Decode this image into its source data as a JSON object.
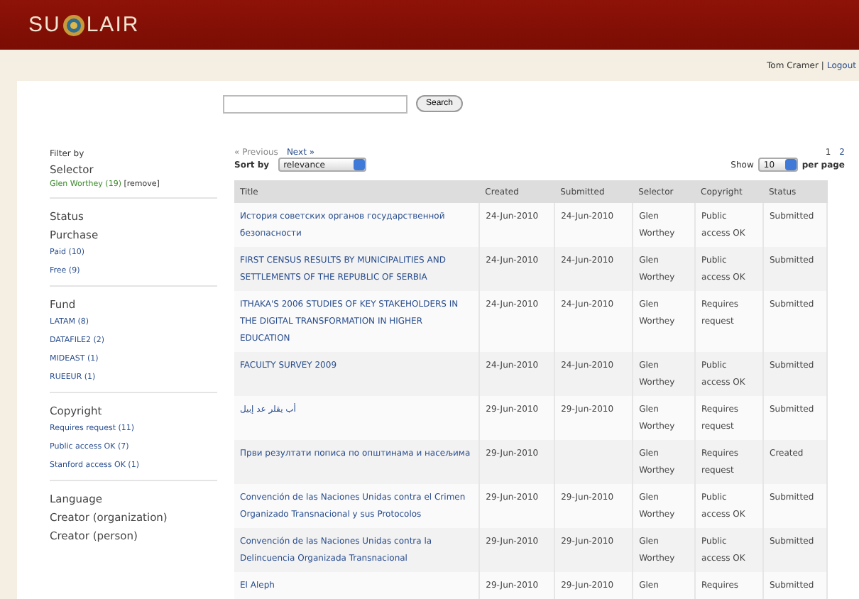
{
  "header": {
    "logo_left": "SU",
    "logo_right": "LAIR"
  },
  "user_bar": {
    "user": "Tom Cramer",
    "separator": "|",
    "logout": "Logout"
  },
  "search": {
    "button": "Search"
  },
  "sidebar": {
    "title": "Filter by",
    "active_filter": {
      "facet": "Selector",
      "value": "Glen Worthey (19)",
      "remove": "[remove]"
    },
    "sections": [
      [
        {
          "heading": "Status"
        },
        {
          "heading": "Purchase",
          "items": [
            "Paid (10)",
            "Free (9)"
          ]
        }
      ],
      [
        {
          "heading": "Fund",
          "items": [
            "LATAM (8)",
            "DATAFILE2 (2)",
            "MIDEAST (1)",
            "RUEEUR (1)"
          ]
        }
      ],
      [
        {
          "heading": "Copyright",
          "items": [
            "Requires request (11)",
            "Public access OK (7)",
            "Stanford access OK (1)"
          ]
        }
      ],
      [
        {
          "heading": "Language"
        },
        {
          "heading": "Creator (organization)"
        },
        {
          "heading": "Creator (person)"
        }
      ]
    ]
  },
  "pager": {
    "previous": {
      "label": "« Previous",
      "disabled": true
    },
    "next": {
      "label": "Next »",
      "disabled": false
    },
    "pages": [
      {
        "label": "1",
        "selected": true
      },
      {
        "label": "2",
        "selected": false
      }
    ]
  },
  "sort": {
    "label": "Sort by",
    "value": "relevance"
  },
  "per_page": {
    "label": "Show",
    "value": "10",
    "suffix": "per page"
  },
  "table": {
    "columns": [
      "Title",
      "Created",
      "Submitted",
      "Selector",
      "Copyright",
      "Status"
    ],
    "rows": [
      [
        "История советских органов государственной безопасности",
        "24-Jun-2010",
        "24-Jun-2010",
        "Glen Worthey",
        "Public access OK",
        "Submitted"
      ],
      [
        "FIRST CENSUS RESULTS BY MUNICIPALITIES AND SETTLEMENTS OF THE REPUBLIC OF SERBIA",
        "24-Jun-2010",
        "24-Jun-2010",
        "Glen Worthey",
        "Public access OK",
        "Submitted"
      ],
      [
        "ITHAKA'S 2006 STUDIES OF KEY STAKEHOLDERS IN THE DIGITAL TRANSFORMATION IN HIGHER EDUCATION",
        "24-Jun-2010",
        "24-Jun-2010",
        "Glen Worthey",
        "Requires request",
        "Submitted"
      ],
      [
        "FACULTY SURVEY 2009",
        "24-Jun-2010",
        "24-Jun-2010",
        "Glen Worthey",
        "Public access OK",
        "Submitted"
      ],
      [
        "أب يقلر عد إبيل",
        "29-Jun-2010",
        "29-Jun-2010",
        "Glen Worthey",
        "Requires request",
        "Submitted"
      ],
      [
        "Први резултати пописа по општинама и насељима",
        "29-Jun-2010",
        "",
        "Glen Worthey",
        "Requires request",
        "Created"
      ],
      [
        "Convención de las Naciones Unidas contra el Crimen Organizado Transnacional y sus Protocolos",
        "29-Jun-2010",
        "29-Jun-2010",
        "Glen Worthey",
        "Public access OK",
        "Submitted"
      ],
      [
        "Convención de las Naciones Unidas contra la Delincuencia Organizada Transnacional",
        "29-Jun-2010",
        "29-Jun-2010",
        "Glen Worthey",
        "Public access OK",
        "Submitted"
      ],
      [
        "El Aleph",
        "29-Jun-2010",
        "29-Jun-2010",
        "Glen",
        "Requires",
        "Submitted"
      ]
    ]
  }
}
